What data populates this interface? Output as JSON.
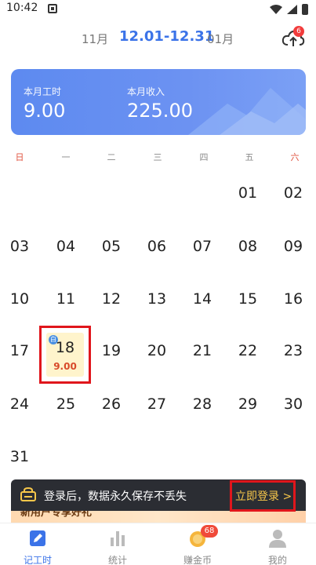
{
  "status_bar": {
    "time": "10:42"
  },
  "month_nav": {
    "prev": "11月",
    "current": "12.01-12.31",
    "next": "01月",
    "cloud_badge": "6"
  },
  "summary": {
    "hours_label": "本月工时",
    "hours_value": "9.00",
    "income_label": "本月收入",
    "income_value": "225.00"
  },
  "weekdays": [
    "日",
    "一",
    "二",
    "三",
    "四",
    "五",
    "六"
  ],
  "calendar": {
    "days": [
      "01",
      "02",
      "03",
      "04",
      "05",
      "06",
      "07",
      "08",
      "09",
      "10",
      "11",
      "12",
      "13",
      "14",
      "15",
      "16",
      "17",
      "18",
      "19",
      "20",
      "21",
      "22",
      "23",
      "24",
      "25",
      "26",
      "27",
      "28",
      "29",
      "30",
      "31"
    ],
    "today_badge": "白",
    "today_amount": "9.00"
  },
  "login_banner": {
    "text": "登录后，数据永久保存不丢失",
    "button": "立即登录 >"
  },
  "promo_text": "新用户专享好礼",
  "tabbar": {
    "tabs": [
      {
        "label": "记工时"
      },
      {
        "label": "统计"
      },
      {
        "label": "赚金币"
      },
      {
        "label": "我的"
      }
    ],
    "coin_badge": "68"
  },
  "colors": {
    "accent": "#3B73E8",
    "highlight": "#e0161c",
    "card": "#5D8AF0",
    "today_bg": "#FFF4CC"
  }
}
